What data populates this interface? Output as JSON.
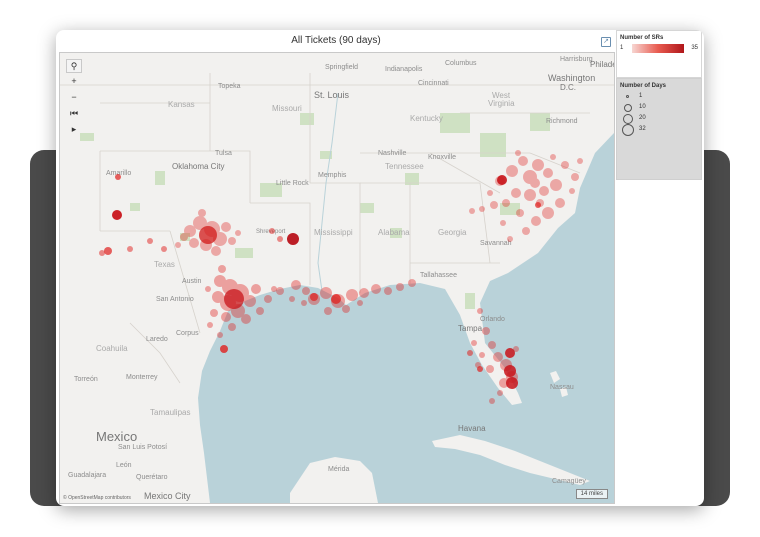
{
  "window": {
    "title": "All Tickets (90 days)"
  },
  "toolbar": {
    "export_icon": "export-icon"
  },
  "map_controls": {
    "search": "⚲",
    "zoom_in": "+",
    "zoom_out": "−",
    "home": "⏮",
    "play": "▸"
  },
  "map": {
    "attribution": "© OpenStreetMap contributors",
    "scale": "14 miles",
    "labels": {
      "springfield": "Springfield",
      "indianapolis": "Indianapolis",
      "columbus": "Columbus",
      "harrisburg": "Harrisburg",
      "philadelphia": "Philadel",
      "washington": "Washington",
      "dc": "D.C.",
      "topeka": "Topeka",
      "cincinnati": "Cincinnati",
      "st_louis": "St. Louis",
      "kansas": "Kansas",
      "missouri": "Missouri",
      "west": "West",
      "virginia": "Virginia",
      "kentucky": "Kentucky",
      "richmond": "Richmond",
      "tulsa": "Tulsa",
      "nashville": "Nashville",
      "knoxville": "Knoxville",
      "oklahoma_city": "Oklahoma City",
      "memphis": "Memphis",
      "tennessee": "Tennessee",
      "amarillo": "Amarillo",
      "little_rock": "Little Rock",
      "alabama": "Alabama",
      "georgia": "Georgia",
      "mississippi": "Mississippi",
      "savannah": "Savannah",
      "shreveport": "Shreveport",
      "texas": "Texas",
      "austin": "Austin",
      "tallahassee": "Tallahassee",
      "san_antonio": "San Antonio",
      "orlando": "Orlando",
      "corpus": "Corpus",
      "tampa": "Tampa",
      "laredo": "Laredo",
      "coahuila": "Coahuila",
      "monterrey": "Monterrey",
      "torreon": "Torreón",
      "nassau": "Nassau",
      "tamaulipas": "Tamaulipas",
      "havana": "Havana",
      "mexico": "Mexico",
      "san_luis_potosi": "San Luis Potosí",
      "merida": "Mérida",
      "leon": "León",
      "queretaro": "Querétaro",
      "guadalajara": "Guadalajara",
      "mexico_city": "Mexico City",
      "camaguey": "Camagüey"
    }
  },
  "legend_sr": {
    "title": "Number of SRs",
    "min": "1",
    "max": "35",
    "color_low": "#f7d6d2",
    "color_high": "#b0161a"
  },
  "legend_days": {
    "title": "Number of Days",
    "values": [
      "1",
      "10",
      "20",
      "32"
    ]
  },
  "colors": {
    "water": "#b9d2d9",
    "land": "#f2f1ef",
    "point": "#e0201e"
  }
}
